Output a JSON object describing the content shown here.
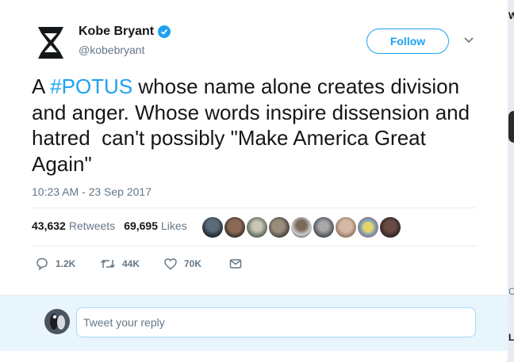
{
  "user": {
    "name": "Kobe Bryant",
    "handle": "@kobebryant",
    "verified": true,
    "avatar_icon": "hourglass-logo"
  },
  "follow_label": "Follow",
  "tweet": {
    "text_before": "A ",
    "hashtag": "#POTUS",
    "text_after": " whose name alone creates division and anger. Whose words inspire dissension and hatred  can't possibly \"Make America Great Again\"",
    "timestamp": "10:23 AM - 23 Sep 2017"
  },
  "stats": {
    "retweets_count": "43,632",
    "retweets_label": "Retweets",
    "likes_count": "69,695",
    "likes_label": "Likes"
  },
  "liker_avatars": 9,
  "actions": {
    "reply_count": "1.2K",
    "retweet_count": "44K",
    "like_count": "70K"
  },
  "reply": {
    "placeholder": "Tweet your reply"
  },
  "colors": {
    "accent": "#1da1f2",
    "text": "#14171a",
    "muted": "#657786",
    "reply_bg": "#e8f5fd"
  }
}
